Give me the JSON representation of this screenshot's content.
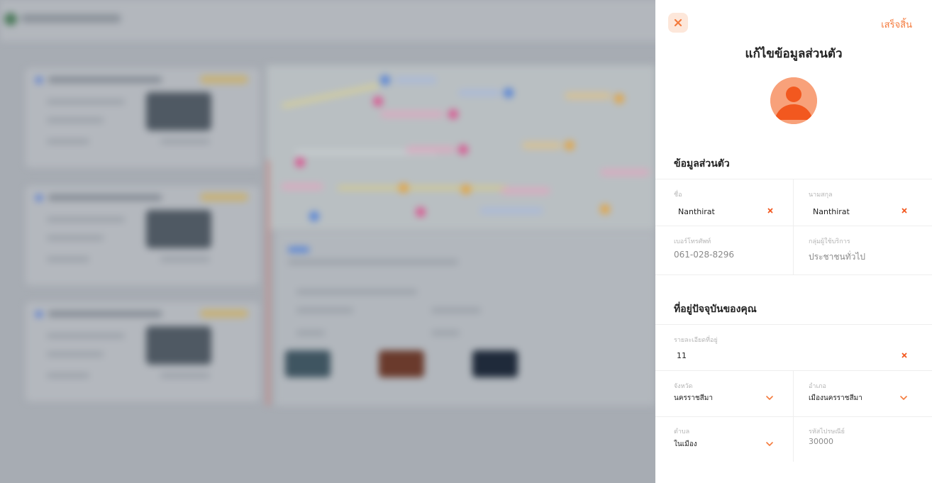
{
  "panel": {
    "close_icon": "close-icon",
    "done_label": "เสร็จสิ้น",
    "title": "แก้ไขข้อมูลส่วนตัว",
    "avatar_icon": "user-avatar-icon",
    "accent_color": "#f47a3c"
  },
  "personal": {
    "section_title": "ข้อมูลส่วนตัว",
    "first_name": {
      "label": "ชื่อ",
      "value": "Nanthirat"
    },
    "last_name": {
      "label": "นามสกุล",
      "value": "Nanthirat"
    },
    "phone": {
      "label": "เบอร์โทรศัพท์",
      "value": "061-028-8296"
    },
    "user_group": {
      "label": "กลุ่มผู้ใช้บริการ",
      "value": "ประชาชนทั่วไป"
    }
  },
  "address": {
    "section_title": "ที่อยู่ปัจจุบันของคุณ",
    "detail": {
      "label": "รายละเอียดที่อยู่",
      "value": "11"
    },
    "province": {
      "label": "จังหวัด",
      "value": "นครราชสีมา"
    },
    "district": {
      "label": "อำเภอ",
      "value": "เมืองนครราชสีมา"
    },
    "subdistrict": {
      "label": "ตำบล",
      "value": "ในเมือง"
    },
    "postal_code": {
      "label": "รหัสไปรษณีย์",
      "value": "30000"
    }
  }
}
